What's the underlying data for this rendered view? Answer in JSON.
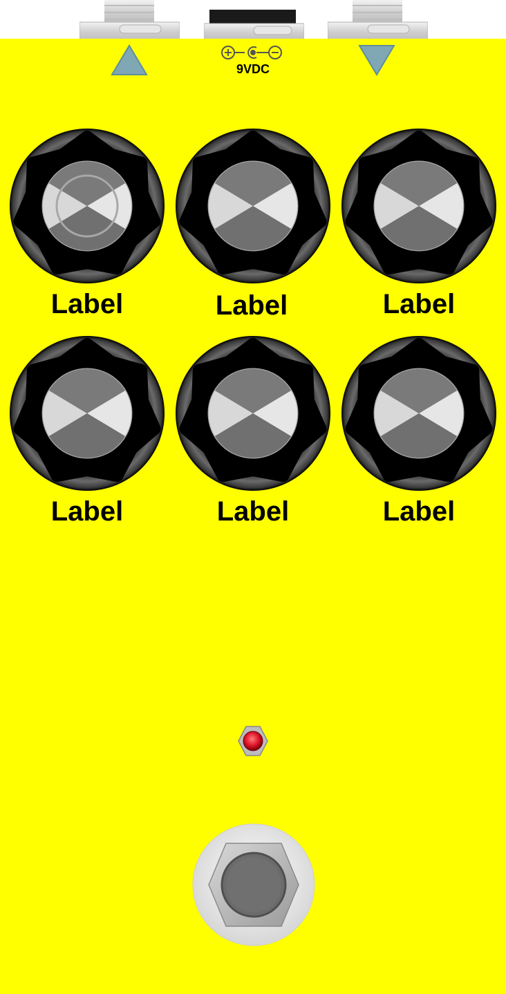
{
  "pedal": {
    "enclosure_color": "#ffff00",
    "arrow_color": "#7fa8b4",
    "power_label": "9VDC",
    "power_icon": "dc-polarity-icon",
    "led_color": "#e0182b"
  },
  "knobs": [
    {
      "label": "Label"
    },
    {
      "label": "Label"
    },
    {
      "label": "Label"
    },
    {
      "label": "Label"
    },
    {
      "label": "Label"
    },
    {
      "label": "Label"
    }
  ]
}
